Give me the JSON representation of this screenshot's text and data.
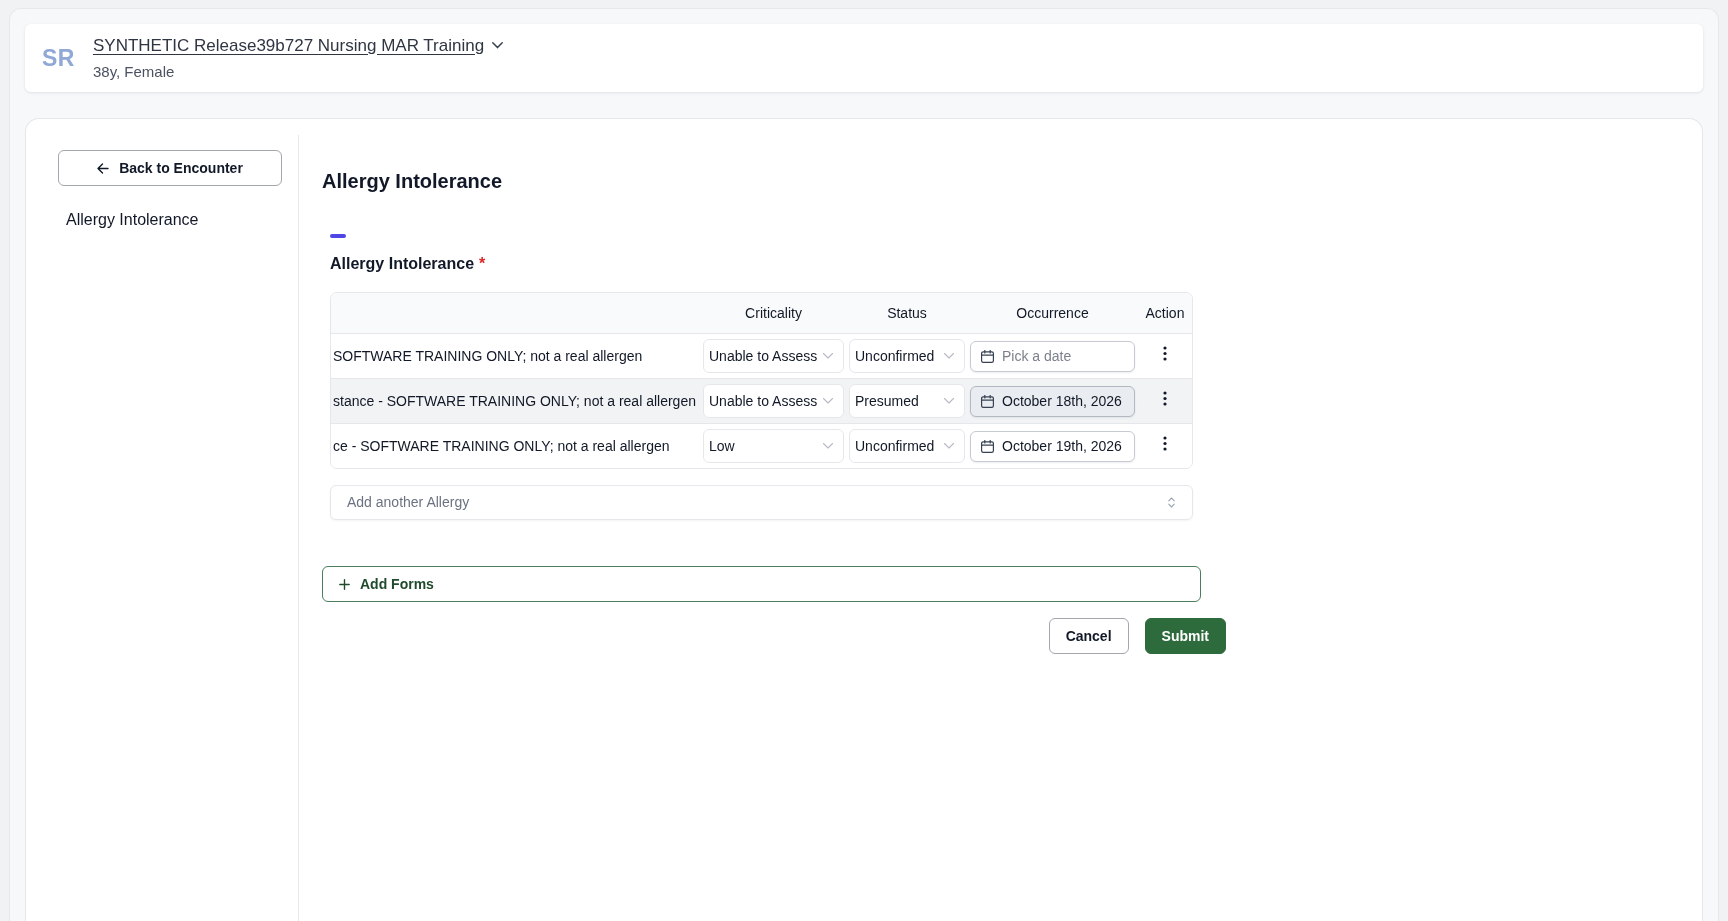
{
  "patient": {
    "initials": "SR",
    "name": "SYNTHETIC Release39b727 Nursing MAR Training",
    "details": "38y, Female"
  },
  "sidebar": {
    "back_button": "Back to Encounter",
    "items": [
      {
        "label": "Allergy Intolerance"
      }
    ]
  },
  "form": {
    "title": "Allergy Intolerance",
    "section": {
      "label": "Allergy Intolerance",
      "required_mark": "*",
      "table": {
        "columns": [
          "Criticality",
          "Status",
          "Occurrence",
          "Action"
        ],
        "rows": [
          {
            "column_1": "SOFTWARE TRAINING ONLY; not a real allergen",
            "criticality": "Unable to Assess",
            "status": "Unconfirmed",
            "occurrence": {
              "placeholder": "Pick a date",
              "hovered": false
            },
            "hovered": false
          },
          {
            "column_1": "stance - SOFTWARE TRAINING ONLY; not a real allergen",
            "criticality": "Unable to Assess",
            "status": "Presumed",
            "occurrence": {
              "value": "October 18th, 2026",
              "hovered": true
            },
            "hovered": true
          },
          {
            "column_1": "ce - SOFTWARE TRAINING ONLY; not a real allergen",
            "criticality": "Low",
            "status": "Unconfirmed",
            "occurrence": {
              "value": "October 19th, 2026",
              "hovered": false
            },
            "hovered": false
          }
        ]
      },
      "add_field": {
        "placeholder": "Add another Allergy"
      }
    },
    "add_forms_button": "Add Forms",
    "buttons": [
      {
        "label": "Cancel",
        "kind": "secondary"
      },
      {
        "label": "Submit",
        "kind": "primary"
      }
    ]
  }
}
